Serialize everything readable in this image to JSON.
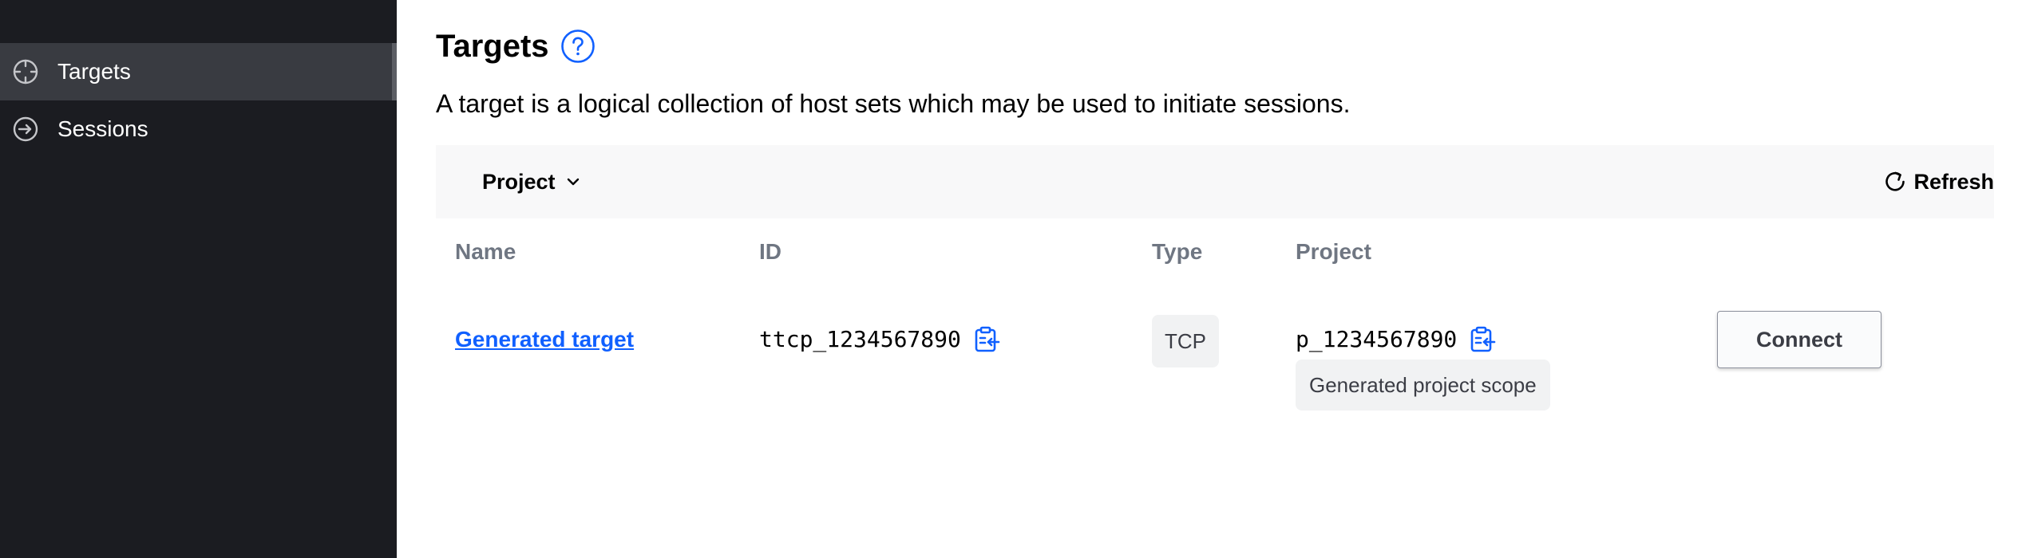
{
  "sidebar": {
    "items": [
      {
        "label": "Targets",
        "icon": "crosshair-icon",
        "active": true
      },
      {
        "label": "Sessions",
        "icon": "sign-in-icon",
        "active": false
      }
    ]
  },
  "header": {
    "title": "Targets",
    "help_icon": "help-circle-icon",
    "description": "A target is a logical collection of host sets which may be used to initiate sessions."
  },
  "toolbar": {
    "project_filter_label": "Project",
    "project_filter_icon": "chevron-down-icon",
    "refresh_label": "Refresh",
    "refresh_icon": "reload-icon"
  },
  "table": {
    "columns": [
      "Name",
      "ID",
      "Type",
      "Project"
    ],
    "rows": [
      {
        "name": "Generated target",
        "id": "ttcp_1234567890",
        "type": "TCP",
        "project_id": "p_1234567890",
        "project_scope": "Generated project scope",
        "action_label": "Connect"
      }
    ]
  },
  "colors": {
    "sidebar_bg": "#1b1c21",
    "sidebar_active_bg": "#393b41",
    "link": "#1060ff",
    "header_text": "#6f7682",
    "badge_bg": "#f1f2f3",
    "toolbar_bg": "#f8f8f9"
  }
}
